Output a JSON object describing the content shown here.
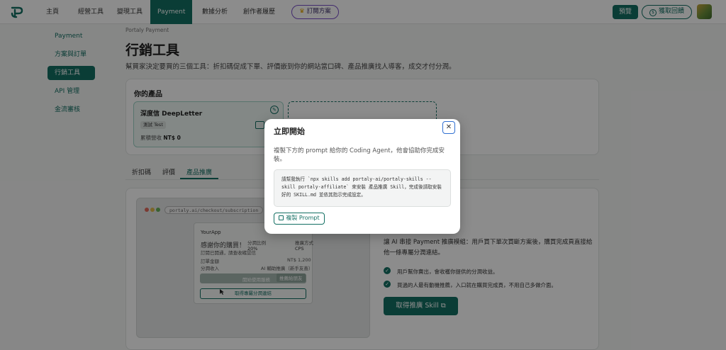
{
  "nav": {
    "items": [
      {
        "label": "主頁"
      },
      {
        "label": "經營工具"
      },
      {
        "label": "變現工具"
      },
      {
        "label": "Payment",
        "active": true
      },
      {
        "label": "數據分析"
      },
      {
        "label": "創作者履歷"
      }
    ],
    "subscribe_label": "訂閱方案",
    "preview_label": "預覽",
    "earn_label": "獲取回饋"
  },
  "sidebar": {
    "items": [
      {
        "label": "Payment"
      },
      {
        "label": "方案與訂單"
      },
      {
        "label": "行銷工具",
        "active": true
      },
      {
        "label": "API 管理"
      },
      {
        "label": "金流審核"
      }
    ]
  },
  "main": {
    "breadcrumb": "Portaly Payment",
    "title": "行銷工具",
    "description": "幫買家決定要買的三個工具：折扣碼促成下單、評價嵌到你的網站當口碑、產品推廣找人導客，成交才付分潤。",
    "products": {
      "heading": "你的產品",
      "card": {
        "name": "深度信 DeepLetter",
        "badge": "測試 Test",
        "revenue_label": "累積營收",
        "revenue_value": "NT$ 0"
      }
    },
    "tabs": [
      {
        "label": "折扣碼"
      },
      {
        "label": "評價"
      },
      {
        "label": "產品推廣",
        "active": true
      }
    ],
    "mock": {
      "url": "portaly.ai/checkout/subscription",
      "app_name": "YourApp",
      "thanks": "感謝你的購買！",
      "sub1": "訂閱已開通，請查收確認信",
      "col1": "分潤比例",
      "col1_val": "20%",
      "col2": "推廣方式",
      "col2_val": "CPS",
      "row1": "訂單金額",
      "row1_val": "NT$ 1,200",
      "row2": "分潤收入",
      "row2_val": "AI 輔助推廣（新手友善）",
      "btn1": "開始使用服務",
      "btn1_tag": "推薦給朋友",
      "btn2": "取得專屬分潤連結"
    },
    "promo": {
      "description": "讓 AI 串接 Payment 推廣模組：用戶買下單次買斷方案後，購買完成頁直接給他一條專屬分潤連結。",
      "checks": [
        "用戶幫你賣出，會收穫你提供的分潤收益。",
        "買過的人最有動機推薦，入口就在購買完成頁，不用自己多做介面。"
      ],
      "button_label": "取得推廣 Skill"
    }
  },
  "modal": {
    "title": "立即開始",
    "close_symbol": "✕",
    "description": "複製下方的 prompt 給你的 Coding Agent，他會協助你完成安裝。",
    "prompt": "請幫我執行 `npx skills add portaly-ai/portaly-skills --skill portaly-affiliate` 來安裝 產品推廣 Skill，完成後請取安裝好的 SKILL.md 並依其指示完成設定。",
    "copy_label": "複製 Prompt"
  },
  "colors": {
    "accent": "#136f63",
    "subscribe_border": "#7a4fc9"
  }
}
